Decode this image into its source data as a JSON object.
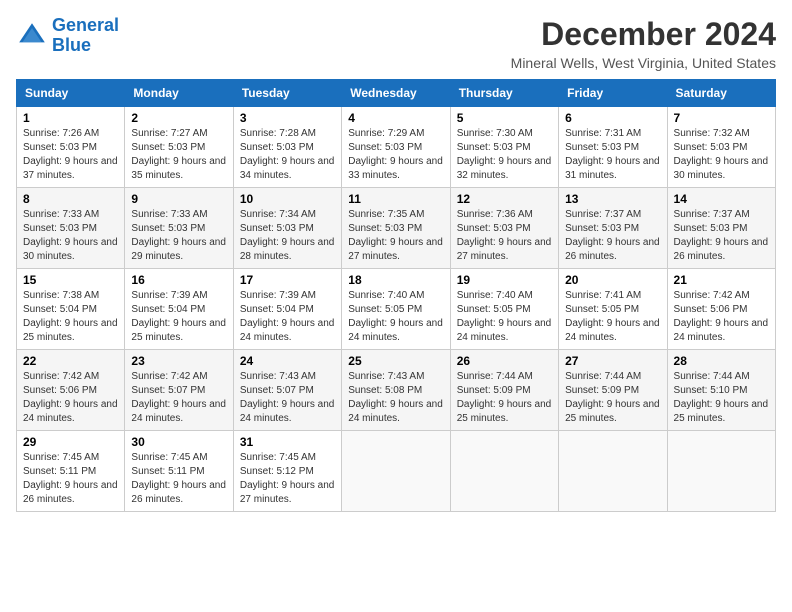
{
  "logo": {
    "line1": "General",
    "line2": "Blue"
  },
  "title": "December 2024",
  "subtitle": "Mineral Wells, West Virginia, United States",
  "days_header": [
    "Sunday",
    "Monday",
    "Tuesday",
    "Wednesday",
    "Thursday",
    "Friday",
    "Saturday"
  ],
  "weeks": [
    [
      {
        "day": "1",
        "sunrise": "7:26 AM",
        "sunset": "5:03 PM",
        "daylight": "9 hours and 37 minutes."
      },
      {
        "day": "2",
        "sunrise": "7:27 AM",
        "sunset": "5:03 PM",
        "daylight": "9 hours and 35 minutes."
      },
      {
        "day": "3",
        "sunrise": "7:28 AM",
        "sunset": "5:03 PM",
        "daylight": "9 hours and 34 minutes."
      },
      {
        "day": "4",
        "sunrise": "7:29 AM",
        "sunset": "5:03 PM",
        "daylight": "9 hours and 33 minutes."
      },
      {
        "day": "5",
        "sunrise": "7:30 AM",
        "sunset": "5:03 PM",
        "daylight": "9 hours and 32 minutes."
      },
      {
        "day": "6",
        "sunrise": "7:31 AM",
        "sunset": "5:03 PM",
        "daylight": "9 hours and 31 minutes."
      },
      {
        "day": "7",
        "sunrise": "7:32 AM",
        "sunset": "5:03 PM",
        "daylight": "9 hours and 30 minutes."
      }
    ],
    [
      {
        "day": "8",
        "sunrise": "7:33 AM",
        "sunset": "5:03 PM",
        "daylight": "9 hours and 30 minutes."
      },
      {
        "day": "9",
        "sunrise": "7:33 AM",
        "sunset": "5:03 PM",
        "daylight": "9 hours and 29 minutes."
      },
      {
        "day": "10",
        "sunrise": "7:34 AM",
        "sunset": "5:03 PM",
        "daylight": "9 hours and 28 minutes."
      },
      {
        "day": "11",
        "sunrise": "7:35 AM",
        "sunset": "5:03 PM",
        "daylight": "9 hours and 27 minutes."
      },
      {
        "day": "12",
        "sunrise": "7:36 AM",
        "sunset": "5:03 PM",
        "daylight": "9 hours and 27 minutes."
      },
      {
        "day": "13",
        "sunrise": "7:37 AM",
        "sunset": "5:03 PM",
        "daylight": "9 hours and 26 minutes."
      },
      {
        "day": "14",
        "sunrise": "7:37 AM",
        "sunset": "5:03 PM",
        "daylight": "9 hours and 26 minutes."
      }
    ],
    [
      {
        "day": "15",
        "sunrise": "7:38 AM",
        "sunset": "5:04 PM",
        "daylight": "9 hours and 25 minutes."
      },
      {
        "day": "16",
        "sunrise": "7:39 AM",
        "sunset": "5:04 PM",
        "daylight": "9 hours and 25 minutes."
      },
      {
        "day": "17",
        "sunrise": "7:39 AM",
        "sunset": "5:04 PM",
        "daylight": "9 hours and 24 minutes."
      },
      {
        "day": "18",
        "sunrise": "7:40 AM",
        "sunset": "5:05 PM",
        "daylight": "9 hours and 24 minutes."
      },
      {
        "day": "19",
        "sunrise": "7:40 AM",
        "sunset": "5:05 PM",
        "daylight": "9 hours and 24 minutes."
      },
      {
        "day": "20",
        "sunrise": "7:41 AM",
        "sunset": "5:05 PM",
        "daylight": "9 hours and 24 minutes."
      },
      {
        "day": "21",
        "sunrise": "7:42 AM",
        "sunset": "5:06 PM",
        "daylight": "9 hours and 24 minutes."
      }
    ],
    [
      {
        "day": "22",
        "sunrise": "7:42 AM",
        "sunset": "5:06 PM",
        "daylight": "9 hours and 24 minutes."
      },
      {
        "day": "23",
        "sunrise": "7:42 AM",
        "sunset": "5:07 PM",
        "daylight": "9 hours and 24 minutes."
      },
      {
        "day": "24",
        "sunrise": "7:43 AM",
        "sunset": "5:07 PM",
        "daylight": "9 hours and 24 minutes."
      },
      {
        "day": "25",
        "sunrise": "7:43 AM",
        "sunset": "5:08 PM",
        "daylight": "9 hours and 24 minutes."
      },
      {
        "day": "26",
        "sunrise": "7:44 AM",
        "sunset": "5:09 PM",
        "daylight": "9 hours and 25 minutes."
      },
      {
        "day": "27",
        "sunrise": "7:44 AM",
        "sunset": "5:09 PM",
        "daylight": "9 hours and 25 minutes."
      },
      {
        "day": "28",
        "sunrise": "7:44 AM",
        "sunset": "5:10 PM",
        "daylight": "9 hours and 25 minutes."
      }
    ],
    [
      {
        "day": "29",
        "sunrise": "7:45 AM",
        "sunset": "5:11 PM",
        "daylight": "9 hours and 26 minutes."
      },
      {
        "day": "30",
        "sunrise": "7:45 AM",
        "sunset": "5:11 PM",
        "daylight": "9 hours and 26 minutes."
      },
      {
        "day": "31",
        "sunrise": "7:45 AM",
        "sunset": "5:12 PM",
        "daylight": "9 hours and 27 minutes."
      },
      null,
      null,
      null,
      null
    ]
  ]
}
